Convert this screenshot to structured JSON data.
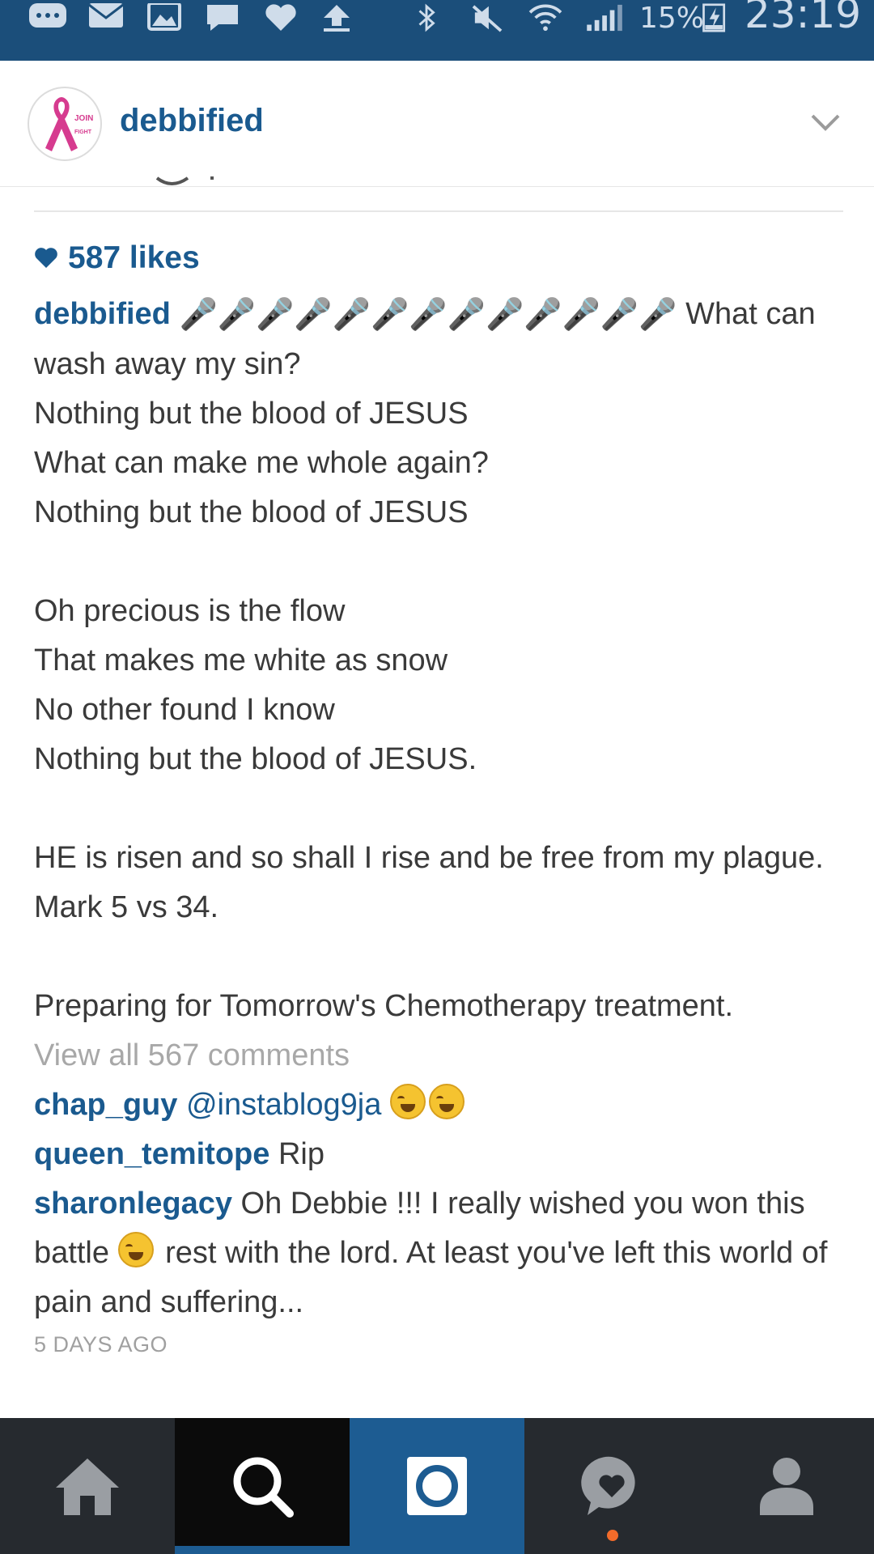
{
  "status_bar": {
    "battery": "15%",
    "time": "23:19"
  },
  "header": {
    "avatar_text_top": "JOIN",
    "avatar_text_bottom": "FIGHT",
    "username": "debbified"
  },
  "post": {
    "likes": "587 likes",
    "caption": {
      "username": "debbified",
      "mic_emojis": "🎤🎤🎤🎤🎤🎤🎤🎤🎤🎤🎤🎤🎤",
      "line1_rest": " What can wash away my sin?",
      "line2": "Nothing but the blood of JESUS",
      "line3": "What can make me whole again?",
      "line4": "Nothing but the blood of JESUS",
      "line5": "Oh precious is the flow",
      "line6": "That makes me white as snow",
      "line7": "No other found I know",
      "line8": "Nothing but the blood of JESUS.",
      "line9": "HE is risen and so shall I rise and be free from my plague. Mark 5 vs 34.",
      "line10": "Preparing for Tomorrow's Chemotherapy treatment."
    },
    "view_all_comments": "View all 567 comments",
    "comments": [
      {
        "username": "chap_guy",
        "text_mention": "@instablog9ja",
        "text": ""
      },
      {
        "username": "queen_temitope",
        "text": " Rip"
      },
      {
        "username": "sharonlegacy",
        "text_before": " Oh Debbie !!! I really wished you won this battle ",
        "text_after": " rest with the lord. At least you've left this world of pain and suffering..."
      }
    ],
    "timestamp": "5 DAYS AGO"
  },
  "bottom_nav": {
    "items": [
      "home-icon",
      "search-icon",
      "camera-icon",
      "activity-icon",
      "profile-icon"
    ]
  },
  "colors": {
    "status_bar": "#1b4e7a",
    "link_blue": "#1a5a8f",
    "nav_bg": "#262a2f",
    "nav_active_blue": "#1d5c92",
    "notification_dot": "#f26b2a"
  }
}
